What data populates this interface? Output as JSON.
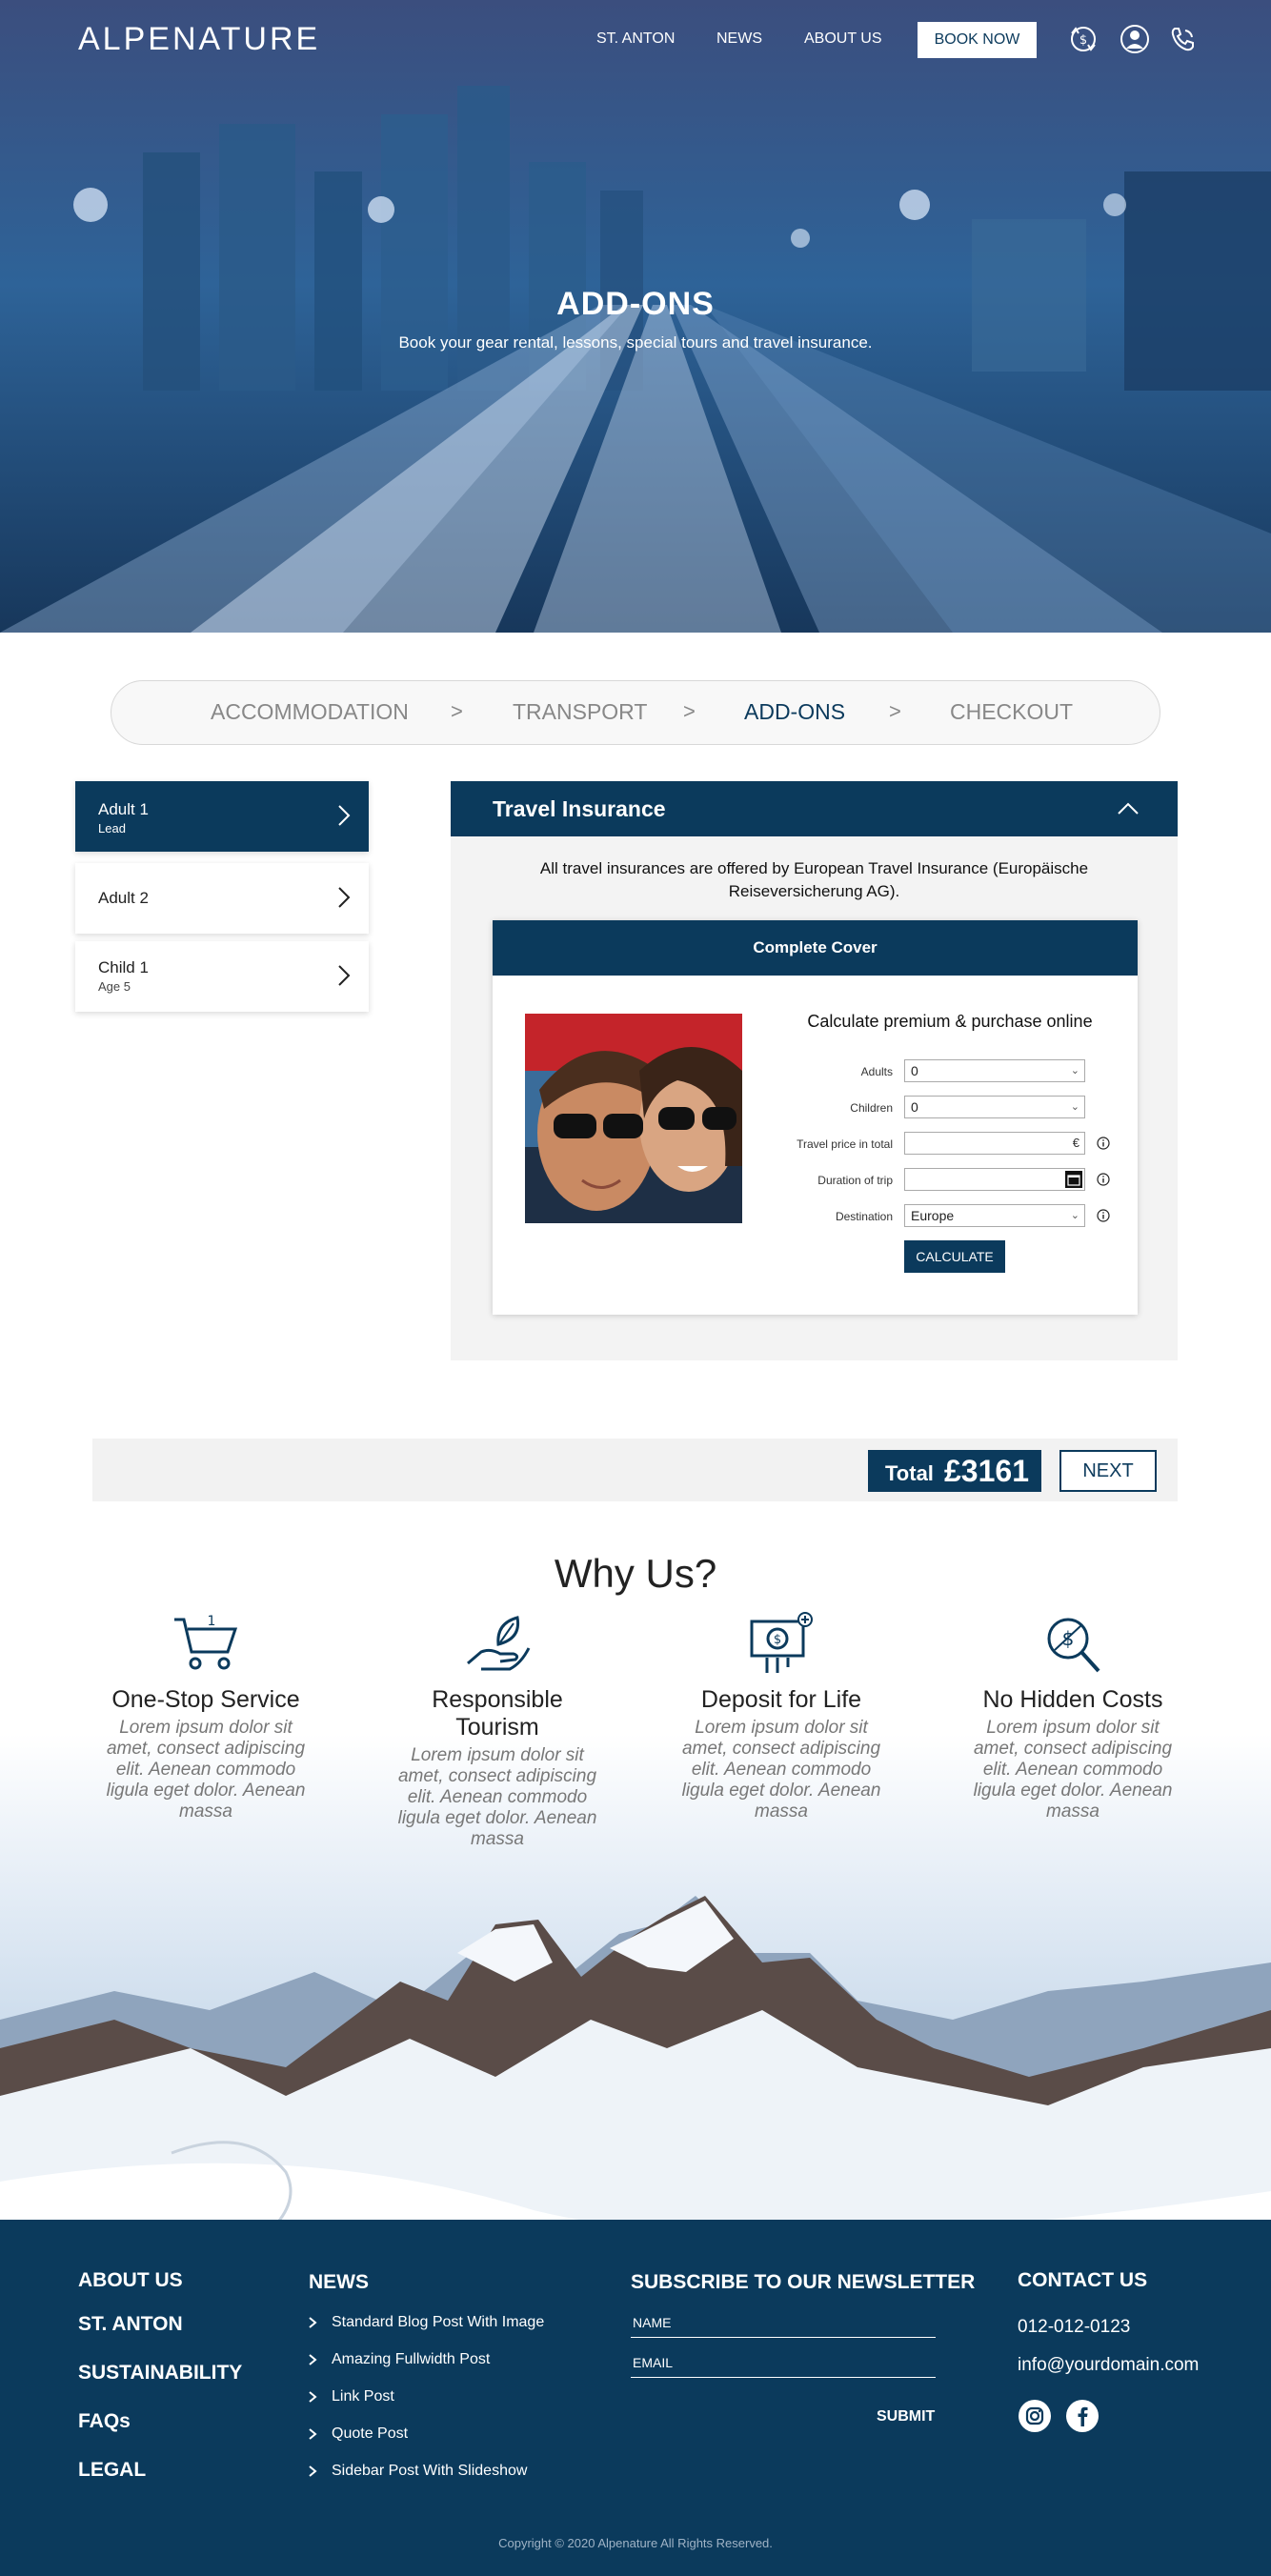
{
  "header": {
    "logo": "ALPENATURE",
    "nav": [
      "ST. ANTON",
      "NEWS",
      "ABOUT US"
    ],
    "book_now": "BOOK NOW"
  },
  "hero": {
    "title": "ADD-ONS",
    "subtitle": "Book your gear rental, lessons, special tours and travel insurance."
  },
  "steps": [
    "ACCOMMODATION",
    "TRANSPORT",
    "ADD-ONS",
    "CHECKOUT"
  ],
  "step_separator": ">",
  "travellers": [
    {
      "name": "Adult 1",
      "sub": "Lead"
    },
    {
      "name": "Adult 2",
      "sub": ""
    },
    {
      "name": "Child 1",
      "sub": "Age 5"
    }
  ],
  "insurance": {
    "title": "Travel Insurance",
    "info": "All travel insurances are offered by European Travel Insurance (Europäische Reiseversicherung AG).",
    "plan": "Complete Cover",
    "calc_title": "Calculate premium & purchase online",
    "fields": [
      {
        "label": "Adults",
        "value": "0"
      },
      {
        "label": "Children",
        "value": "0"
      },
      {
        "label": "Travel price in total",
        "value": "",
        "suffix": "€"
      },
      {
        "label": "Duration of trip",
        "value": ""
      },
      {
        "label": "Destination",
        "value": "Europe"
      }
    ],
    "calculate": "CALCULATE"
  },
  "total": {
    "label": "Total",
    "value": "£3161",
    "next": "NEXT"
  },
  "why_us": {
    "title": "Why Us?",
    "features": [
      {
        "title": "One-Stop Service",
        "text": "Lorem ipsum dolor sit amet, consect adipiscing elit. Aenean commodo ligula eget dolor. Aenean massa",
        "icon": "shopping-cart-icon"
      },
      {
        "title": "Responsible Tourism",
        "text": "Lorem ipsum dolor sit amet, consect adipiscing elit. Aenean commodo ligula eget dolor. Aenean massa",
        "icon": "hand-leaf-icon"
      },
      {
        "title": "Deposit for Life",
        "text": "Lorem ipsum dolor sit amet, consect adipiscing elit. Aenean commodo ligula eget dolor. Aenean massa",
        "icon": "money-icon"
      },
      {
        "title": "No Hidden Costs",
        "text": "Lorem ipsum dolor sit amet, consect adipiscing elit. Aenean commodo ligula eget dolor. Aenean massa",
        "icon": "search-dollar-icon"
      }
    ]
  },
  "footer": {
    "links": [
      "ABOUT US",
      "ST. ANTON",
      "SUSTAINABILITY",
      "FAQs",
      "LEGAL"
    ],
    "news_heading": "NEWS",
    "news": [
      "Standard Blog Post With Image",
      "Amazing Fullwidth Post",
      "Link Post",
      "Quote Post",
      "Sidebar Post With Slideshow"
    ],
    "newsletter_heading": "SUBSCRIBE TO OUR NEWSLETTER",
    "name_placeholder": "NAME",
    "email_placeholder": "EMAIL",
    "submit": "SUBMIT",
    "contact_heading": "CONTACT US",
    "phone": "012-012-0123",
    "email": "info@yourdomain.com",
    "copyright": "Copyright © 2020  Alpenature  All Rights Reserved."
  },
  "colors": {
    "primary": "#0b3a5c",
    "panel_bg": "#f3f3f3"
  }
}
